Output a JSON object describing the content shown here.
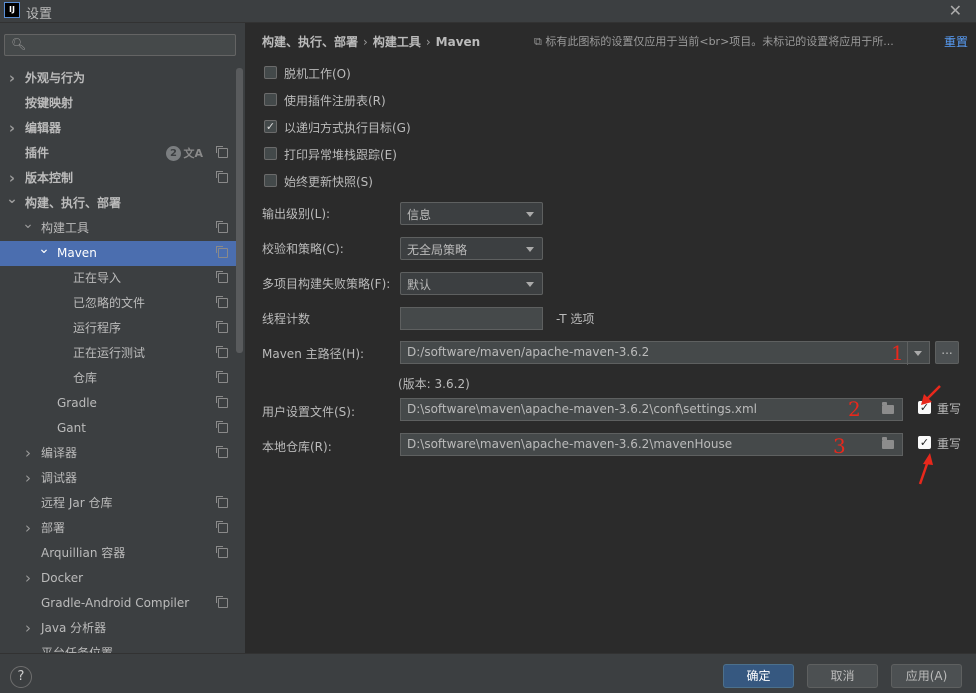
{
  "window": {
    "title": "设置",
    "app_icon_text": "IJ"
  },
  "search": {
    "placeholder": ""
  },
  "sidebar": {
    "items": [
      {
        "label": "外观与行为",
        "bold": true,
        "chevron": "right",
        "indent": 0,
        "copy": false
      },
      {
        "label": "按键映射",
        "bold": true,
        "chevron": "",
        "indent": 0,
        "copy": false
      },
      {
        "label": "编辑器",
        "bold": true,
        "chevron": "right",
        "indent": 0,
        "copy": false
      },
      {
        "label": "插件",
        "bold": true,
        "chevron": "",
        "indent": 0,
        "copy": true,
        "badge": "2",
        "translate": true
      },
      {
        "label": "版本控制",
        "bold": true,
        "chevron": "right",
        "indent": 0,
        "copy": true
      },
      {
        "label": "构建、执行、部署",
        "bold": true,
        "chevron": "down",
        "indent": 0,
        "copy": false
      },
      {
        "label": "构建工具",
        "bold": false,
        "chevron": "down",
        "indent": 1,
        "copy": true
      },
      {
        "label": "Maven",
        "bold": false,
        "chevron": "down",
        "indent": 2,
        "copy": true,
        "selected": true
      },
      {
        "label": "正在导入",
        "bold": false,
        "chevron": "",
        "indent": 3,
        "copy": true
      },
      {
        "label": "已忽略的文件",
        "bold": false,
        "chevron": "",
        "indent": 3,
        "copy": true
      },
      {
        "label": "运行程序",
        "bold": false,
        "chevron": "",
        "indent": 3,
        "copy": true
      },
      {
        "label": "正在运行测试",
        "bold": false,
        "chevron": "",
        "indent": 3,
        "copy": true
      },
      {
        "label": "仓库",
        "bold": false,
        "chevron": "",
        "indent": 3,
        "copy": true
      },
      {
        "label": "Gradle",
        "bold": false,
        "chevron": "",
        "indent": 2,
        "copy": true
      },
      {
        "label": "Gant",
        "bold": false,
        "chevron": "",
        "indent": 2,
        "copy": true
      },
      {
        "label": "编译器",
        "bold": false,
        "chevron": "right",
        "indent": 1,
        "copy": true
      },
      {
        "label": "调试器",
        "bold": false,
        "chevron": "right",
        "indent": 1,
        "copy": false
      },
      {
        "label": "远程 Jar 仓库",
        "bold": false,
        "chevron": "",
        "indent": 1,
        "copy": true
      },
      {
        "label": "部署",
        "bold": false,
        "chevron": "right",
        "indent": 1,
        "copy": true
      },
      {
        "label": "Arquillian 容器",
        "bold": false,
        "chevron": "",
        "indent": 1,
        "copy": true
      },
      {
        "label": "Docker",
        "bold": false,
        "chevron": "right",
        "indent": 1,
        "copy": false
      },
      {
        "label": "Gradle-Android Compiler",
        "bold": false,
        "chevron": "",
        "indent": 1,
        "copy": true
      },
      {
        "label": "Java 分析器",
        "bold": false,
        "chevron": "right",
        "indent": 1,
        "copy": false
      },
      {
        "label": "平台任务位置",
        "bold": false,
        "chevron": "",
        "indent": 1,
        "copy": false
      }
    ]
  },
  "breadcrumb": {
    "part1": "构建、执行、部署",
    "part2": "构建工具",
    "part3": "Maven",
    "separator": "›"
  },
  "hint": "⧉ 标有此图标的设置仅应用于当前<br>项目。未标记的设置将应用于所...",
  "reset_label": "重置",
  "checkboxes": [
    {
      "label": "脱机工作(O)",
      "checked": false
    },
    {
      "label": "使用插件注册表(R)",
      "checked": false
    },
    {
      "label": "以递归方式执行目标(G)",
      "checked": true
    },
    {
      "label": "打印异常堆栈跟踪(E)",
      "checked": false
    },
    {
      "label": "始终更新快照(S)",
      "checked": false
    }
  ],
  "form": {
    "output_level_label": "输出级别(L):",
    "output_level_value": "信息",
    "checksum_label": "校验和策略(C):",
    "checksum_value": "无全局策略",
    "multiproject_label": "多项目构建失败策略(F):",
    "multiproject_value": "默认",
    "thread_label": "线程计数",
    "thread_value": "",
    "thread_suffix": "-T 选项",
    "maven_home_label": "Maven 主路径(H):",
    "maven_home_value": "D:/software/maven/apache-maven-3.6.2",
    "browse_label": "...",
    "version_text": "(版本: 3.6.2)",
    "user_settings_label": "用户设置文件(S):",
    "user_settings_value": "D:\\software\\maven\\apache-maven-3.6.2\\conf\\settings.xml",
    "local_repo_label": "本地仓库(R):",
    "local_repo_value": "D:\\software\\maven\\apache-maven-3.6.2\\mavenHouse",
    "override_label": "重写"
  },
  "annotations": {
    "n1": "1",
    "n2": "2",
    "n3": "3",
    "color": "#e8281c"
  },
  "footer": {
    "help": "?",
    "ok": "确定",
    "cancel": "取消",
    "apply": "应用(A)"
  },
  "colors": {
    "selection": "#4b6eaf",
    "link": "#589df6",
    "primary_button": "#365880"
  }
}
